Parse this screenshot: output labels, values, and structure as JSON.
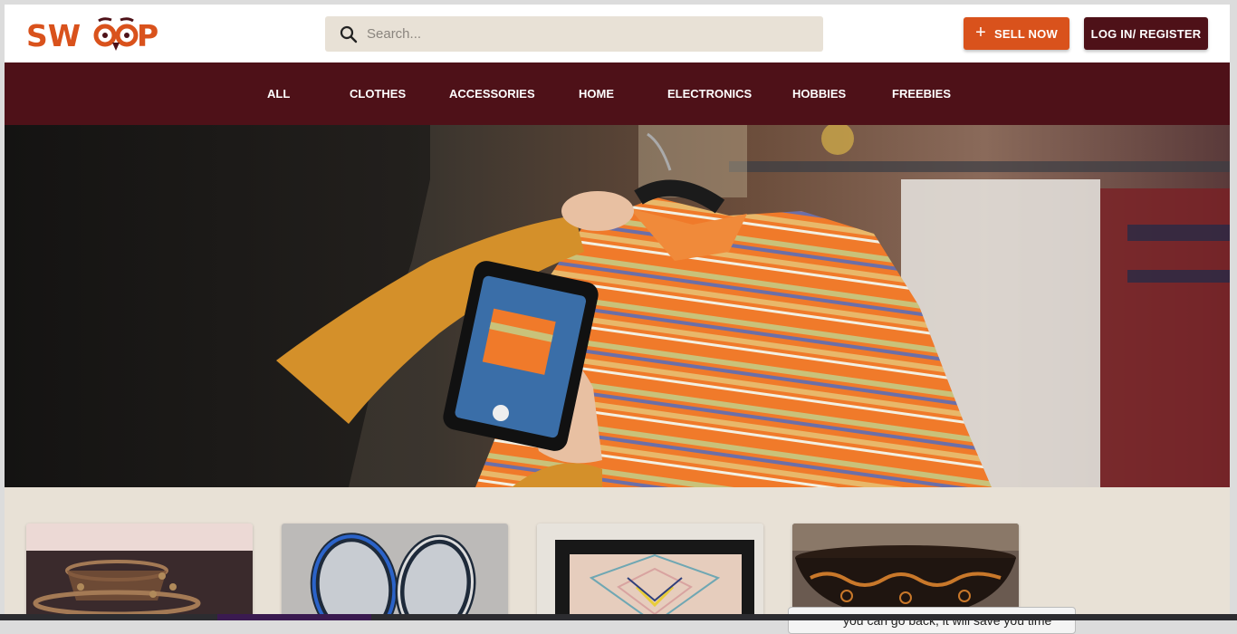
{
  "brand": {
    "logo_text": "SW",
    "logo_text_end": "P",
    "color": "#d9521c"
  },
  "search": {
    "placeholder": "Search..."
  },
  "header": {
    "sell_label": "SELL NOW",
    "login_label": "LOG IN/ REGISTER"
  },
  "nav": {
    "items": [
      {
        "label": "ALL"
      },
      {
        "label": "CLOTHES"
      },
      {
        "label": "ACCESSORIES"
      },
      {
        "label": "HOME"
      },
      {
        "label": "ELECTRONICS"
      },
      {
        "label": "HOBBIES"
      },
      {
        "label": "FREEBIES"
      }
    ]
  },
  "colors": {
    "accent": "#d9521c",
    "maroon": "#4e1118",
    "sand": "#e8e1d6"
  },
  "hero": {
    "icon": "hero-photo"
  },
  "listings": [
    {
      "icon": "beaded-baskets-photo"
    },
    {
      "icon": "tennis-rackets-photo"
    },
    {
      "icon": "geometric-rug-photo"
    },
    {
      "icon": "carved-bowl-photo"
    }
  ],
  "tooltip": {
    "text": "you can go back, it will save you time"
  }
}
